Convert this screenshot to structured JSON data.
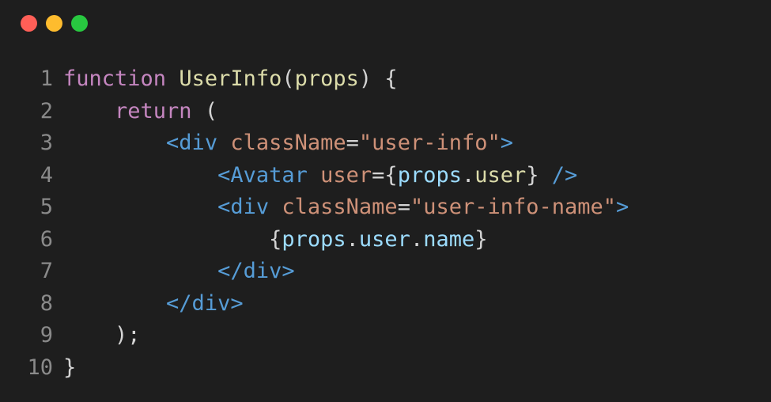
{
  "window": {
    "controls": [
      {
        "name": "close",
        "color": "#ff5f57"
      },
      {
        "name": "minimize",
        "color": "#febc2e"
      },
      {
        "name": "zoom",
        "color": "#28c840"
      }
    ]
  },
  "colors": {
    "background": "#1e1e1e",
    "line_number": "#8a8a8a",
    "keyword": "#c586c0",
    "function": "#dcdcaa",
    "tag": "#569cd6",
    "attribute": "#ce9178",
    "string": "#ce9178",
    "variable": "#9cdcfe",
    "punctuation": "#d4d4d4"
  },
  "code": {
    "lines": [
      {
        "num": "1",
        "tokens": [
          {
            "t": "kw",
            "v": "function"
          },
          {
            "t": "pn",
            "v": " "
          },
          {
            "t": "fn",
            "v": "UserInfo"
          },
          {
            "t": "pn",
            "v": "("
          },
          {
            "t": "fn",
            "v": "props"
          },
          {
            "t": "pn",
            "v": ") {"
          }
        ]
      },
      {
        "num": "2",
        "tokens": [
          {
            "t": "pn",
            "v": "    "
          },
          {
            "t": "kw",
            "v": "return"
          },
          {
            "t": "pn",
            "v": " ("
          }
        ]
      },
      {
        "num": "3",
        "tokens": [
          {
            "t": "pn",
            "v": "        "
          },
          {
            "t": "tag",
            "v": "<div"
          },
          {
            "t": "pn",
            "v": " "
          },
          {
            "t": "attr",
            "v": "className"
          },
          {
            "t": "pn",
            "v": "="
          },
          {
            "t": "str",
            "v": "\"user-info\""
          },
          {
            "t": "tag",
            "v": ">"
          }
        ]
      },
      {
        "num": "4",
        "tokens": [
          {
            "t": "pn",
            "v": "            "
          },
          {
            "t": "tag",
            "v": "<Avatar"
          },
          {
            "t": "pn",
            "v": " "
          },
          {
            "t": "attr",
            "v": "user"
          },
          {
            "t": "pn",
            "v": "={"
          },
          {
            "t": "var",
            "v": "props"
          },
          {
            "t": "pn",
            "v": "."
          },
          {
            "t": "fn",
            "v": "user"
          },
          {
            "t": "pn",
            "v": "}"
          },
          {
            "t": "pn",
            "v": " "
          },
          {
            "t": "tag",
            "v": "/>"
          }
        ]
      },
      {
        "num": "5",
        "tokens": [
          {
            "t": "pn",
            "v": "            "
          },
          {
            "t": "tag",
            "v": "<div"
          },
          {
            "t": "pn",
            "v": " "
          },
          {
            "t": "attr",
            "v": "className"
          },
          {
            "t": "pn",
            "v": "="
          },
          {
            "t": "str",
            "v": "\"user-info-name\""
          },
          {
            "t": "tag",
            "v": ">"
          }
        ]
      },
      {
        "num": "6",
        "tokens": [
          {
            "t": "pn",
            "v": "                "
          },
          {
            "t": "pn",
            "v": "{"
          },
          {
            "t": "var",
            "v": "props"
          },
          {
            "t": "pn",
            "v": "."
          },
          {
            "t": "var",
            "v": "user"
          },
          {
            "t": "pn",
            "v": "."
          },
          {
            "t": "var",
            "v": "name"
          },
          {
            "t": "pn",
            "v": "}"
          }
        ]
      },
      {
        "num": "7",
        "tokens": [
          {
            "t": "pn",
            "v": "            "
          },
          {
            "t": "tag",
            "v": "</div>"
          }
        ]
      },
      {
        "num": "8",
        "tokens": [
          {
            "t": "pn",
            "v": "        "
          },
          {
            "t": "tag",
            "v": "</div>"
          }
        ]
      },
      {
        "num": "9",
        "tokens": [
          {
            "t": "pn",
            "v": "    );"
          }
        ]
      },
      {
        "num": "10",
        "tokens": [
          {
            "t": "pn",
            "v": "}"
          }
        ]
      }
    ]
  }
}
